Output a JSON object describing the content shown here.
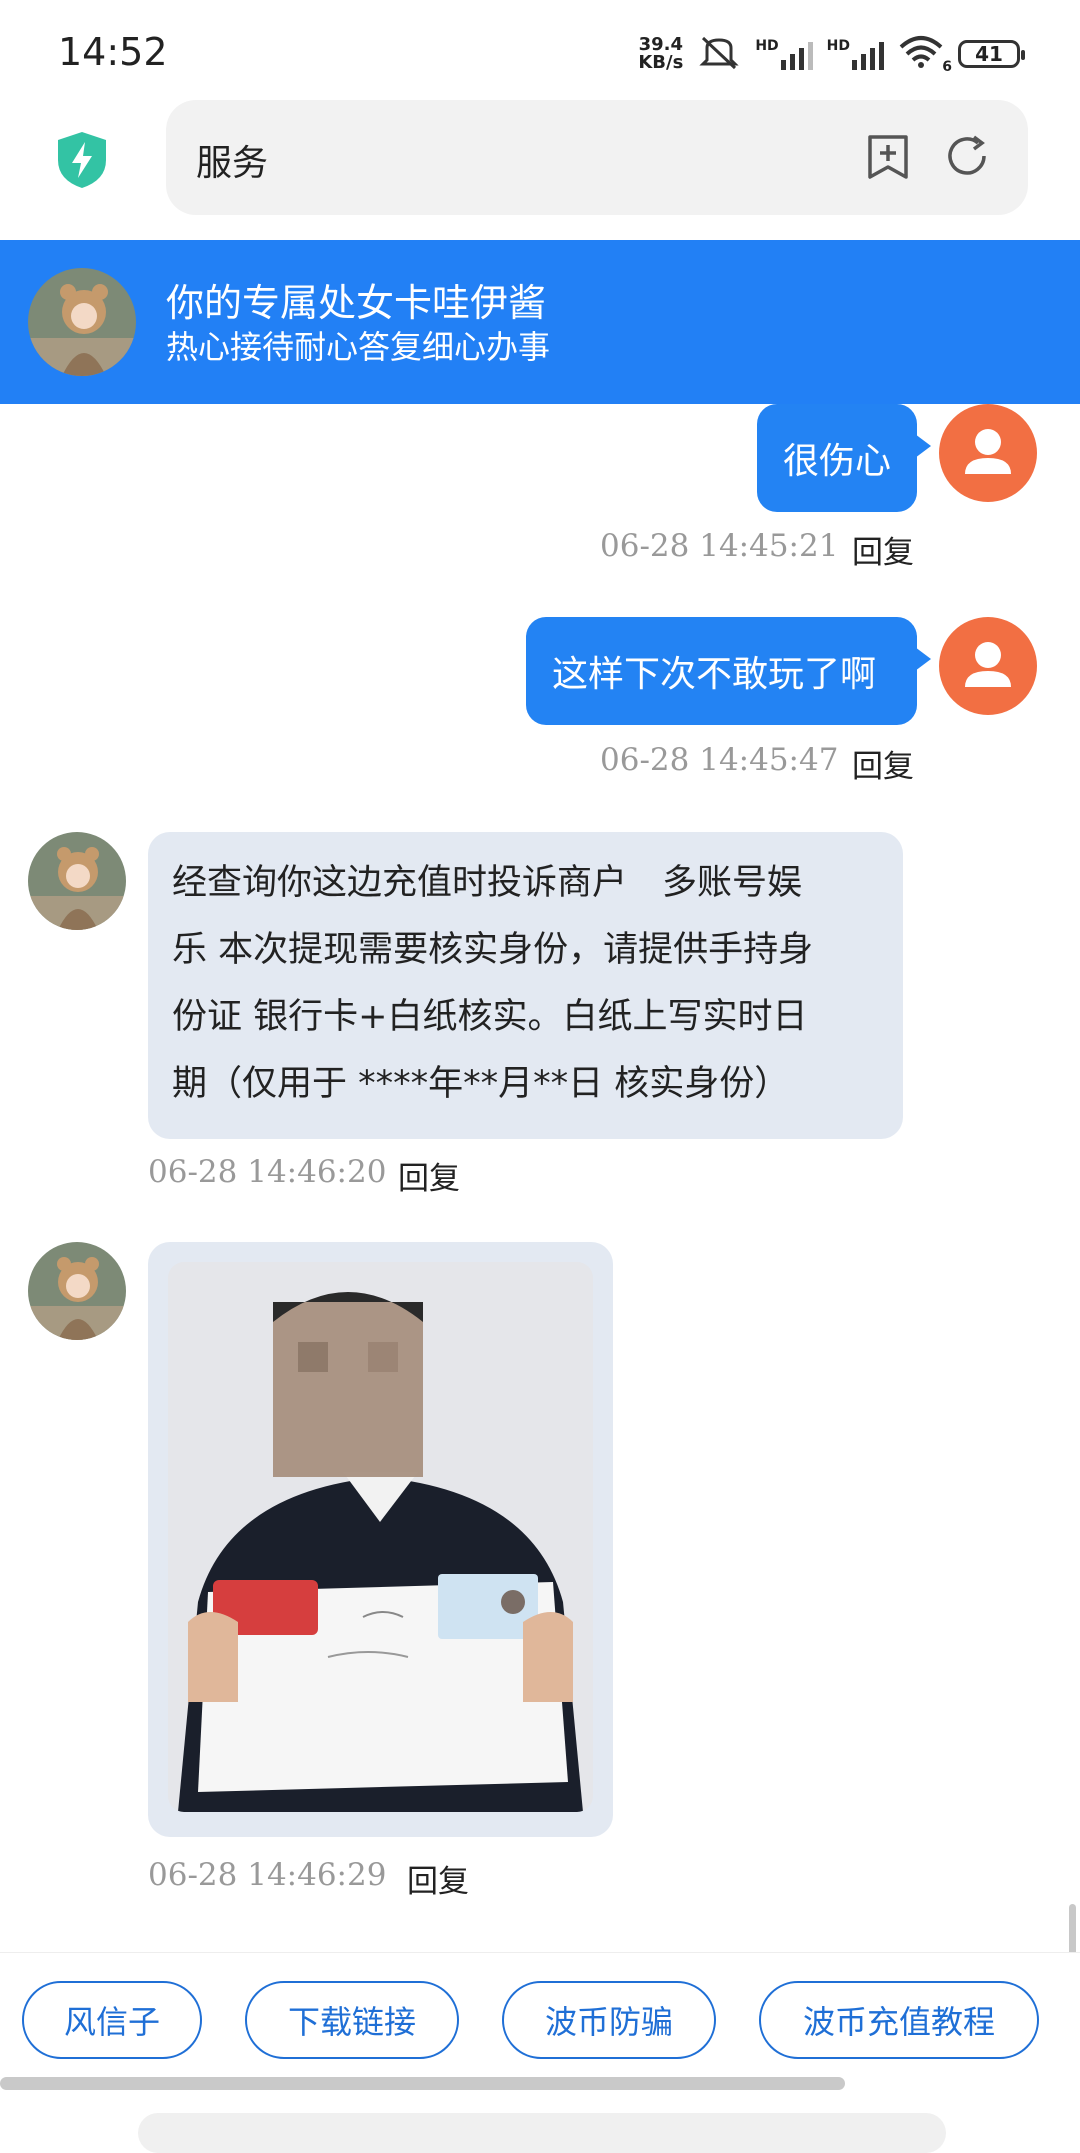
{
  "status_bar": {
    "time": "14:52",
    "net_speed_value": "39.4",
    "net_speed_unit": "KB/s",
    "hd1": "HD",
    "hd2": "HD",
    "wifi_label": "6",
    "battery": "41",
    "icons": [
      "mute-icon",
      "signal-icon",
      "wifi-icon",
      "battery-icon"
    ]
  },
  "top_bar": {
    "title": "服务",
    "icons": [
      "shield-icon",
      "bookmark-add-icon",
      "refresh-icon"
    ]
  },
  "agent_header": {
    "title": "你的专属处女卡哇伊酱",
    "subtitle": "热心接待耐心答复细心办事"
  },
  "messages": [
    {
      "direction": "out",
      "text": "很伤心",
      "time": "06-28 14:45:21",
      "reply": "回复"
    },
    {
      "direction": "out",
      "text": "这样下次不敢玩了啊",
      "time": "06-28 14:45:47",
      "reply": "回复"
    },
    {
      "direction": "in",
      "lines": [
        "经查询你这边充值时投诉商户　多账号娱",
        "乐 本次提现需要核实身份，请提供手持身",
        "份证 银行卡+白纸核实。白纸上写实时日",
        "期（仅用于 ****年**月**日 核实身份）"
      ],
      "time": "06-28 14:46:20",
      "reply": "回复"
    },
    {
      "direction": "in",
      "type": "image",
      "image_desc": "photo",
      "time": "06-28 14:46:29",
      "reply": "回复"
    }
  ],
  "quick_replies": [
    "风信子",
    "下载链接",
    "波币防骗",
    "波币充值教程"
  ],
  "colors": {
    "brand_blue": "#2280f5",
    "bubble_out": "#2383f3",
    "bubble_in": "#e3e9f2",
    "user_avatar": "#f26f43",
    "chip_border": "#1f6fd6"
  }
}
